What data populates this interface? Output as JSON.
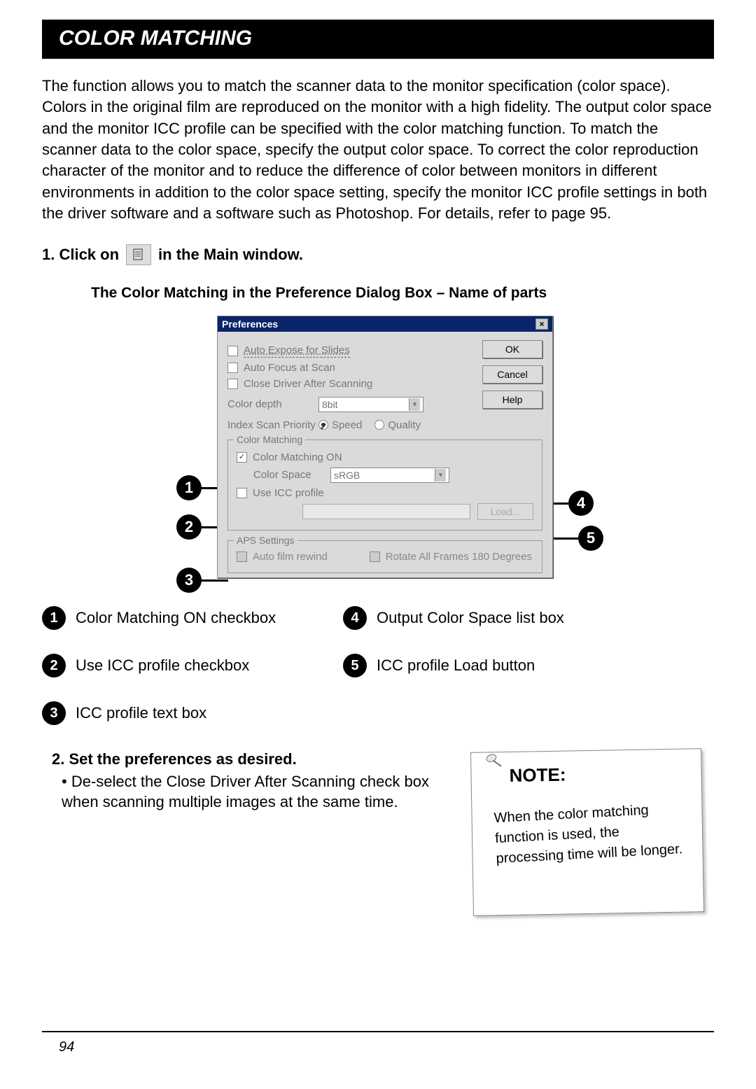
{
  "title": "COLOR MATCHING",
  "intro": "The function allows you to match the scanner data to the monitor specification (color space). Colors in the original film are reproduced on the monitor with a high fidelity. The output color space and the monitor ICC profile can be specified with the color matching function.\nTo match the scanner data to the color space, specify the output color space.\nTo correct the color reproduction character of the monitor and to reduce the difference of color between monitors in different environments in addition to the color space setting, specify the monitor ICC profile settings in both the driver software and a software such as Photoshop. For details, refer to page 95.",
  "step1_pre": "1.  Click on ",
  "step1_post": " in the Main window.",
  "subheading": "The Color Matching in the Preference Dialog Box – Name of parts",
  "dialog": {
    "title": "Preferences",
    "buttons": {
      "ok": "OK",
      "cancel": "Cancel",
      "help": "Help"
    },
    "auto_expose": "Auto Expose for Slides",
    "auto_focus": "Auto Focus at Scan",
    "close_driver": "Close Driver After Scanning",
    "color_depth_label": "Color depth",
    "color_depth_value": "8bit",
    "index_scan_label": "Index Scan Priority",
    "speed": "Speed",
    "quality": "Quality",
    "cm_legend": "Color Matching",
    "cm_on": "Color Matching ON",
    "color_space_label": "Color Space",
    "color_space_value": "sRGB",
    "use_icc": "Use ICC profile",
    "load": "Load...",
    "aps_legend": "APS Settings",
    "aps_rewind": "Auto film rewind",
    "aps_rotate": "Rotate All Frames 180 Degrees"
  },
  "callouts": {
    "c1": "1",
    "c2": "2",
    "c3": "3",
    "c4": "4",
    "c5": "5"
  },
  "legend": {
    "l1": "Color Matching ON checkbox",
    "l2": "Use ICC profile checkbox",
    "l3": "ICC profile text box",
    "l4": "Output Color Space list box",
    "l5": "ICC profile Load button"
  },
  "step2": {
    "head": "2.  Set the preferences as desired.",
    "bullet": "• De-select the Close Driver After Scanning check box when scanning multiple images at the same time."
  },
  "note": {
    "head": "NOTE:",
    "body": "When the color matching function is used, the processing time will be longer."
  },
  "page_num": "94"
}
